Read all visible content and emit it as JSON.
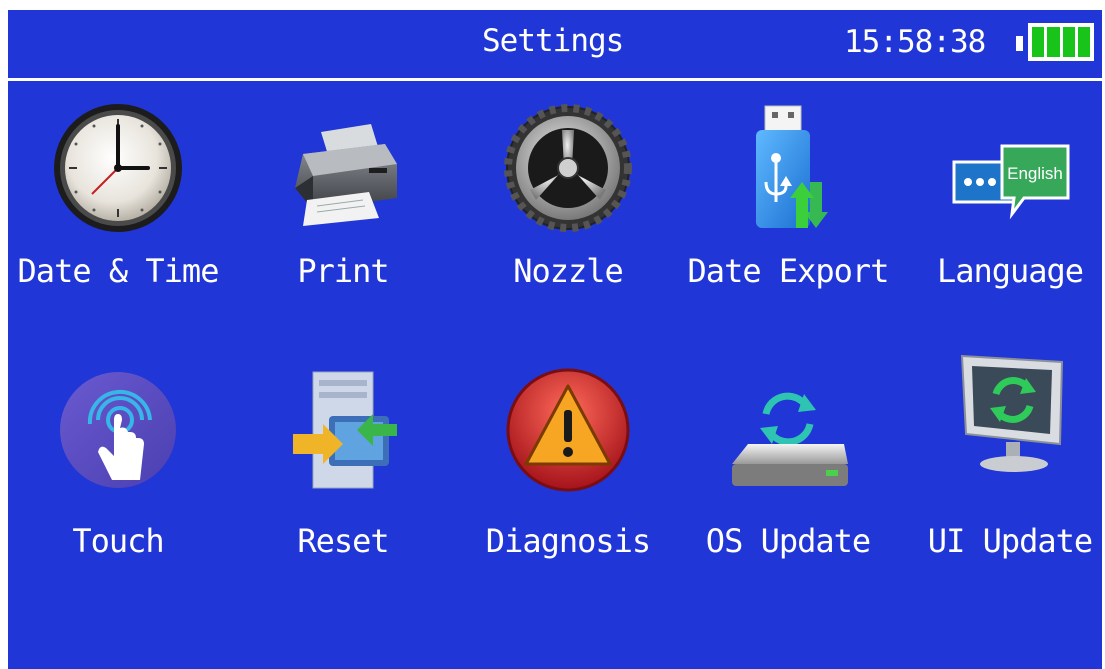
{
  "header": {
    "title": "Settings",
    "clock": "15:58:38",
    "battery": {
      "level": 1.0,
      "cells": 4
    }
  },
  "colors": {
    "background": "#2036d6",
    "text": "#ffffff",
    "battery_fill": "#19c41a"
  },
  "tiles": [
    {
      "label": "Date & Time",
      "icon": "clock-icon"
    },
    {
      "label": "Print",
      "icon": "printer-icon"
    },
    {
      "label": "Nozzle",
      "icon": "gear-icon"
    },
    {
      "label": "Date Export",
      "icon": "usb-export-icon"
    },
    {
      "label": "Language",
      "icon": "language-icon"
    },
    {
      "label": "Touch",
      "icon": "touch-icon"
    },
    {
      "label": "Reset",
      "icon": "reset-icon"
    },
    {
      "label": "Diagnosis",
      "icon": "warning-icon"
    },
    {
      "label": "OS Update",
      "icon": "drive-sync-icon"
    },
    {
      "label": "UI Update",
      "icon": "monitor-sync-icon"
    }
  ],
  "icon_text": {
    "language_badge": "English"
  }
}
